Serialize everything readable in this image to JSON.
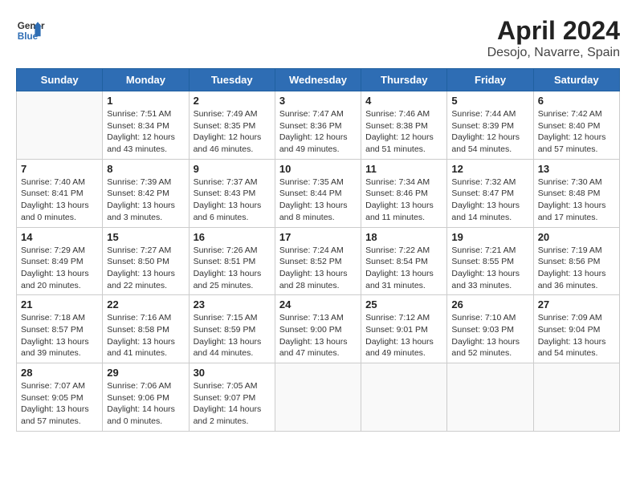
{
  "header": {
    "logo_line1": "General",
    "logo_line2": "Blue",
    "title": "April 2024",
    "subtitle": "Desojo, Navarre, Spain"
  },
  "weekdays": [
    "Sunday",
    "Monday",
    "Tuesday",
    "Wednesday",
    "Thursday",
    "Friday",
    "Saturday"
  ],
  "weeks": [
    [
      {
        "day": "",
        "info": ""
      },
      {
        "day": "1",
        "info": "Sunrise: 7:51 AM\nSunset: 8:34 PM\nDaylight: 12 hours\nand 43 minutes."
      },
      {
        "day": "2",
        "info": "Sunrise: 7:49 AM\nSunset: 8:35 PM\nDaylight: 12 hours\nand 46 minutes."
      },
      {
        "day": "3",
        "info": "Sunrise: 7:47 AM\nSunset: 8:36 PM\nDaylight: 12 hours\nand 49 minutes."
      },
      {
        "day": "4",
        "info": "Sunrise: 7:46 AM\nSunset: 8:38 PM\nDaylight: 12 hours\nand 51 minutes."
      },
      {
        "day": "5",
        "info": "Sunrise: 7:44 AM\nSunset: 8:39 PM\nDaylight: 12 hours\nand 54 minutes."
      },
      {
        "day": "6",
        "info": "Sunrise: 7:42 AM\nSunset: 8:40 PM\nDaylight: 12 hours\nand 57 minutes."
      }
    ],
    [
      {
        "day": "7",
        "info": "Sunrise: 7:40 AM\nSunset: 8:41 PM\nDaylight: 13 hours\nand 0 minutes."
      },
      {
        "day": "8",
        "info": "Sunrise: 7:39 AM\nSunset: 8:42 PM\nDaylight: 13 hours\nand 3 minutes."
      },
      {
        "day": "9",
        "info": "Sunrise: 7:37 AM\nSunset: 8:43 PM\nDaylight: 13 hours\nand 6 minutes."
      },
      {
        "day": "10",
        "info": "Sunrise: 7:35 AM\nSunset: 8:44 PM\nDaylight: 13 hours\nand 8 minutes."
      },
      {
        "day": "11",
        "info": "Sunrise: 7:34 AM\nSunset: 8:46 PM\nDaylight: 13 hours\nand 11 minutes."
      },
      {
        "day": "12",
        "info": "Sunrise: 7:32 AM\nSunset: 8:47 PM\nDaylight: 13 hours\nand 14 minutes."
      },
      {
        "day": "13",
        "info": "Sunrise: 7:30 AM\nSunset: 8:48 PM\nDaylight: 13 hours\nand 17 minutes."
      }
    ],
    [
      {
        "day": "14",
        "info": "Sunrise: 7:29 AM\nSunset: 8:49 PM\nDaylight: 13 hours\nand 20 minutes."
      },
      {
        "day": "15",
        "info": "Sunrise: 7:27 AM\nSunset: 8:50 PM\nDaylight: 13 hours\nand 22 minutes."
      },
      {
        "day": "16",
        "info": "Sunrise: 7:26 AM\nSunset: 8:51 PM\nDaylight: 13 hours\nand 25 minutes."
      },
      {
        "day": "17",
        "info": "Sunrise: 7:24 AM\nSunset: 8:52 PM\nDaylight: 13 hours\nand 28 minutes."
      },
      {
        "day": "18",
        "info": "Sunrise: 7:22 AM\nSunset: 8:54 PM\nDaylight: 13 hours\nand 31 minutes."
      },
      {
        "day": "19",
        "info": "Sunrise: 7:21 AM\nSunset: 8:55 PM\nDaylight: 13 hours\nand 33 minutes."
      },
      {
        "day": "20",
        "info": "Sunrise: 7:19 AM\nSunset: 8:56 PM\nDaylight: 13 hours\nand 36 minutes."
      }
    ],
    [
      {
        "day": "21",
        "info": "Sunrise: 7:18 AM\nSunset: 8:57 PM\nDaylight: 13 hours\nand 39 minutes."
      },
      {
        "day": "22",
        "info": "Sunrise: 7:16 AM\nSunset: 8:58 PM\nDaylight: 13 hours\nand 41 minutes."
      },
      {
        "day": "23",
        "info": "Sunrise: 7:15 AM\nSunset: 8:59 PM\nDaylight: 13 hours\nand 44 minutes."
      },
      {
        "day": "24",
        "info": "Sunrise: 7:13 AM\nSunset: 9:00 PM\nDaylight: 13 hours\nand 47 minutes."
      },
      {
        "day": "25",
        "info": "Sunrise: 7:12 AM\nSunset: 9:01 PM\nDaylight: 13 hours\nand 49 minutes."
      },
      {
        "day": "26",
        "info": "Sunrise: 7:10 AM\nSunset: 9:03 PM\nDaylight: 13 hours\nand 52 minutes."
      },
      {
        "day": "27",
        "info": "Sunrise: 7:09 AM\nSunset: 9:04 PM\nDaylight: 13 hours\nand 54 minutes."
      }
    ],
    [
      {
        "day": "28",
        "info": "Sunrise: 7:07 AM\nSunset: 9:05 PM\nDaylight: 13 hours\nand 57 minutes."
      },
      {
        "day": "29",
        "info": "Sunrise: 7:06 AM\nSunset: 9:06 PM\nDaylight: 14 hours\nand 0 minutes."
      },
      {
        "day": "30",
        "info": "Sunrise: 7:05 AM\nSunset: 9:07 PM\nDaylight: 14 hours\nand 2 minutes."
      },
      {
        "day": "",
        "info": ""
      },
      {
        "day": "",
        "info": ""
      },
      {
        "day": "",
        "info": ""
      },
      {
        "day": "",
        "info": ""
      }
    ]
  ]
}
